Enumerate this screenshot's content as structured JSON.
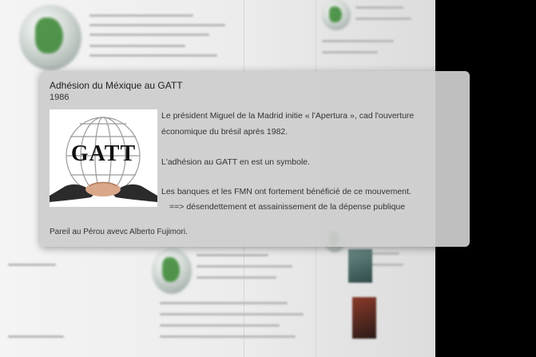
{
  "popup": {
    "title": "Adhésion du Méxique au GATT",
    "year": "1986",
    "logo_text": "GATT",
    "paragraph1": "Le président Miguel de la Madrid initie « l'Apertura », cad l'ouverture économique du brésil après 1982.",
    "paragraph2": "L'adhésion au GATT en est un symbole.",
    "paragraph3": "Les banques et les FMN ont fortement bénéficié de ce mouvement.",
    "paragraph4": "==> désendettement et assainissement de la dépense publique",
    "footer": "Pareil au Pérou avevc Alberto Fujimori."
  },
  "icons": {
    "globe": "globe-icon",
    "logo": "gatt-logo-icon"
  }
}
